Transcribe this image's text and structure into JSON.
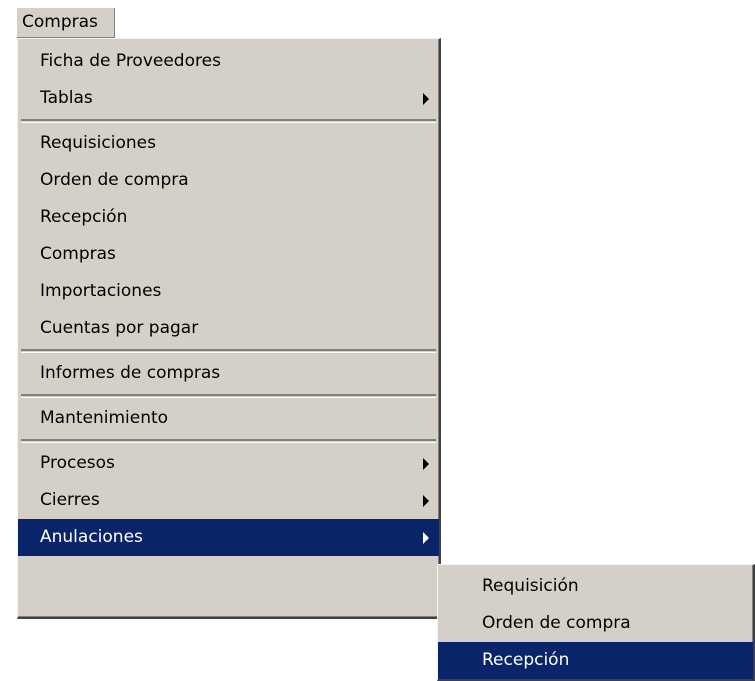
{
  "menubar": {
    "compras_label": "Compras"
  },
  "menu": {
    "ficha_proveedores": "Ficha de Proveedores",
    "tablas": "Tablas",
    "requisiciones": "Requisiciones",
    "orden_compra": "Orden de compra",
    "recepcion": "Recepción",
    "compras": "Compras",
    "importaciones": "Importaciones",
    "cuentas_pagar": "Cuentas por pagar",
    "informes_compras": "Informes de compras",
    "mantenimiento": "Mantenimiento",
    "procesos": "Procesos",
    "cierres": "Cierres",
    "anulaciones": "Anulaciones"
  },
  "submenu": {
    "requisicion": "Requisición",
    "orden_compra": "Orden de compra",
    "recepcion": "Recepción"
  },
  "colors": {
    "menu_background": "#d4d0c8",
    "highlight": "#0a246a",
    "highlight_text": "#ffffff"
  }
}
